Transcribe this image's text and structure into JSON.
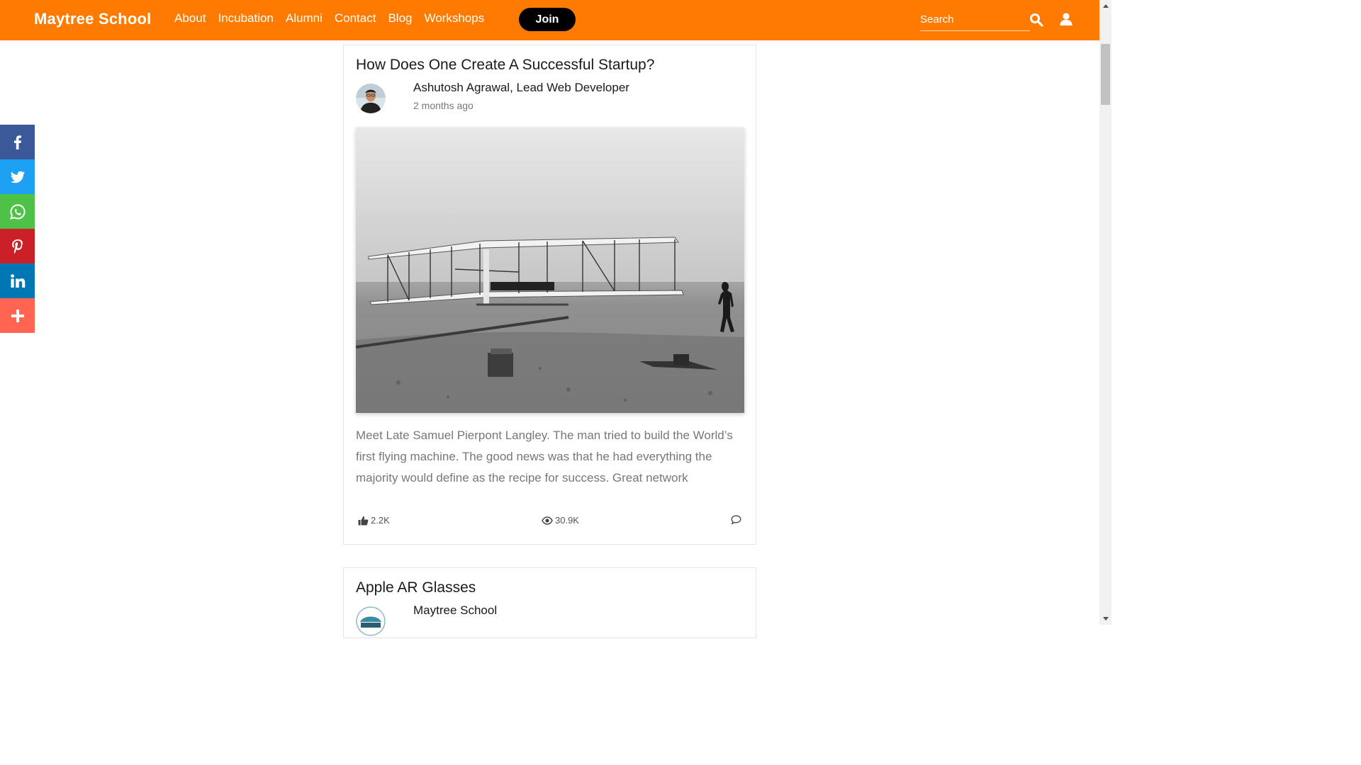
{
  "header": {
    "brand": "Maytree School",
    "nav": [
      "About",
      "Incubation",
      "Alumni",
      "Contact",
      "Blog",
      "Workshops"
    ],
    "join_label": "Join",
    "search_placeholder": "Search",
    "accent_color": "#ff7a00"
  },
  "share": [
    {
      "name": "facebook-icon",
      "color": "#3b5998"
    },
    {
      "name": "twitter-icon",
      "color": "#1da1f2"
    },
    {
      "name": "whatsapp-icon",
      "color": "#4dc247"
    },
    {
      "name": "pinterest-icon",
      "color": "#cb2027"
    },
    {
      "name": "linkedin-icon",
      "color": "#0077b5"
    },
    {
      "name": "more-icon",
      "color": "#ff6550"
    }
  ],
  "posts": [
    {
      "title": "How Does One Create A Successful Startup?",
      "author": "Ashutosh Agrawal, Lead Web Developer",
      "time": "2 months ago",
      "excerpt": "Meet Late Samuel Pierpont Langley. The man tried to build the World’s first flying machine. The good news was that he had everything the majority would define as the recipe for success. Great network",
      "likes": "2.2K",
      "views": "30.9K"
    },
    {
      "title": "Apple AR Glasses",
      "author": "Maytree School"
    }
  ]
}
